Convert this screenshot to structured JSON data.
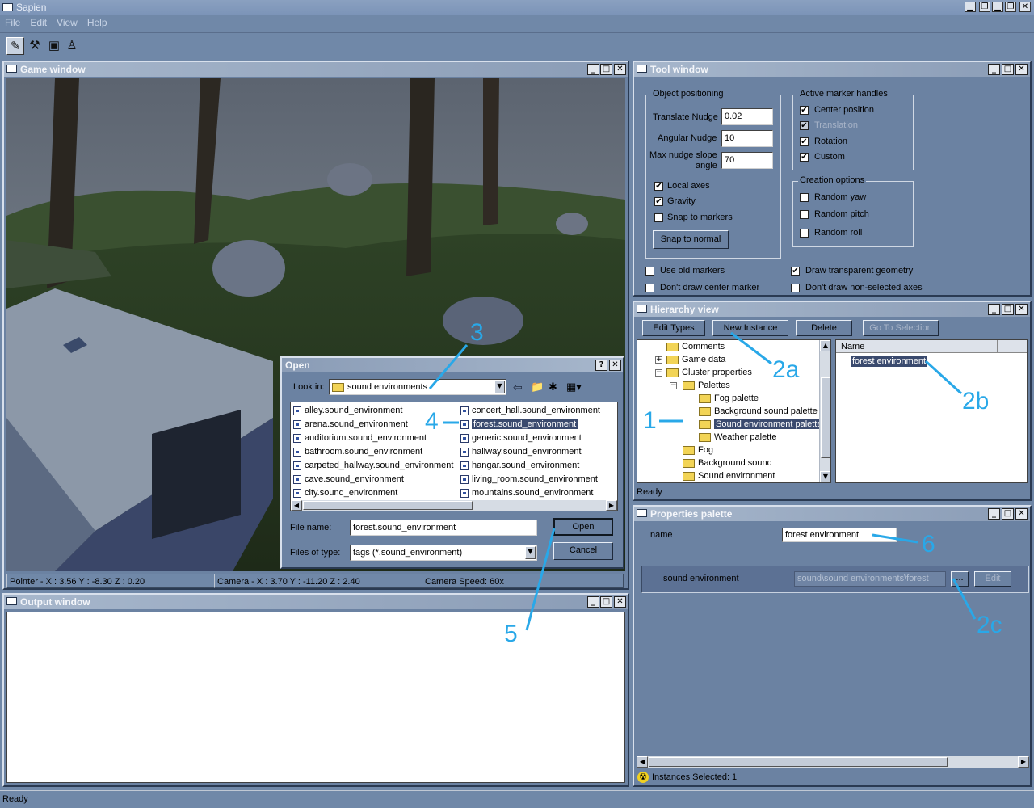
{
  "app": {
    "title": "Sapien",
    "status": "Ready"
  },
  "menu": [
    "File",
    "Edit",
    "View",
    "Help"
  ],
  "toolbar_icons": [
    "pencil-icon",
    "wrench-icon",
    "camera-icon",
    "figure-icon"
  ],
  "game_window": {
    "title": "Game window",
    "status": {
      "pointer": "Pointer - X : 3.56  Y : -8.30  Z : 0.20",
      "camera": "Camera - X : 3.70  Y : -11.20  Z : 2.40",
      "speed": "Camera Speed: 60x"
    }
  },
  "open_dialog": {
    "title": "Open",
    "look_in_label": "Look in:",
    "look_in_value": "sound environments",
    "files_col1": [
      "alley.sound_environment",
      "arena.sound_environment",
      "auditorium.sound_environment",
      "bathroom.sound_environment",
      "carpeted_hallway.sound_environment",
      "cave.sound_environment",
      "city.sound_environment"
    ],
    "files_col2": [
      "concert_hall.sound_environment",
      "forest.sound_environment",
      "generic.sound_environment",
      "hallway.sound_environment",
      "hangar.sound_environment",
      "living_room.sound_environment",
      "mountains.sound_environment"
    ],
    "file_name_label": "File name:",
    "file_name_value": "forest.sound_environment",
    "files_of_type_label": "Files of type:",
    "files_of_type_value": "tags (*.sound_environment)",
    "open_label": "Open",
    "cancel_label": "Cancel"
  },
  "output_window": {
    "title": "Output window"
  },
  "tool_window": {
    "title": "Tool window",
    "object_positioning": {
      "title": "Object positioning",
      "translate_nudge_label": "Translate Nudge",
      "translate_nudge_value": "0.02",
      "angular_nudge_label": "Angular Nudge",
      "angular_nudge_value": "10",
      "max_slope_label_1": "Max nudge slope",
      "max_slope_label_2": "angle",
      "max_slope_value": "70",
      "local_axes": "Local axes",
      "gravity": "Gravity",
      "snap_to_markers": "Snap to markers",
      "snap_to_normal": "Snap to normal"
    },
    "active_marker_handles": {
      "title": "Active marker handles",
      "center_position": "Center position",
      "translation": "Translation",
      "rotation": "Rotation",
      "custom": "Custom"
    },
    "creation_options": {
      "title": "Creation options",
      "random_yaw": "Random yaw",
      "random_pitch": "Random pitch",
      "random_roll": "Random roll"
    },
    "use_old_markers": "Use old markers",
    "dont_draw_center_marker": "Don't draw center marker",
    "draw_transparent_geometry": "Draw transparent geometry",
    "dont_draw_non_selected_axes": "Don't draw non-selected axes"
  },
  "hierarchy_view": {
    "title": "Hierarchy view",
    "buttons": {
      "edit_types": "Edit Types",
      "new_instance": "New Instance",
      "delete": "Delete",
      "go_to_selection": "Go To Selection"
    },
    "tree": {
      "comments": "Comments",
      "game_data": "Game data",
      "cluster_properties": "Cluster properties",
      "palettes": "Palettes",
      "fog_palette": "Fog palette",
      "background_sound_palette": "Background sound palette",
      "sound_environment_palette": "Sound environment palette",
      "weather_palette": "Weather palette",
      "fog": "Fog",
      "background_sound": "Background sound",
      "sound_environment": "Sound environment"
    },
    "list_header": "Name",
    "list_item": "forest environment",
    "status": "Ready"
  },
  "properties_palette": {
    "title": "Properties palette",
    "name_label": "name",
    "name_value": "forest environment",
    "sound_env_label": "sound environment",
    "sound_env_value": "sound\\sound environments\\forest",
    "browse_label": "...",
    "edit_label": "Edit",
    "status": "Instances Selected: 1"
  },
  "annotations": {
    "a1": "1",
    "a2a": "2a",
    "a2b": "2b",
    "a2c": "2c",
    "a3": "3",
    "a4": "4",
    "a5": "5",
    "a6": "6"
  },
  "colors": {
    "desktop": "#7088a8",
    "panel": "#6b82a2",
    "annotation": "#29a8e8",
    "selection": "#3a4a6e"
  }
}
